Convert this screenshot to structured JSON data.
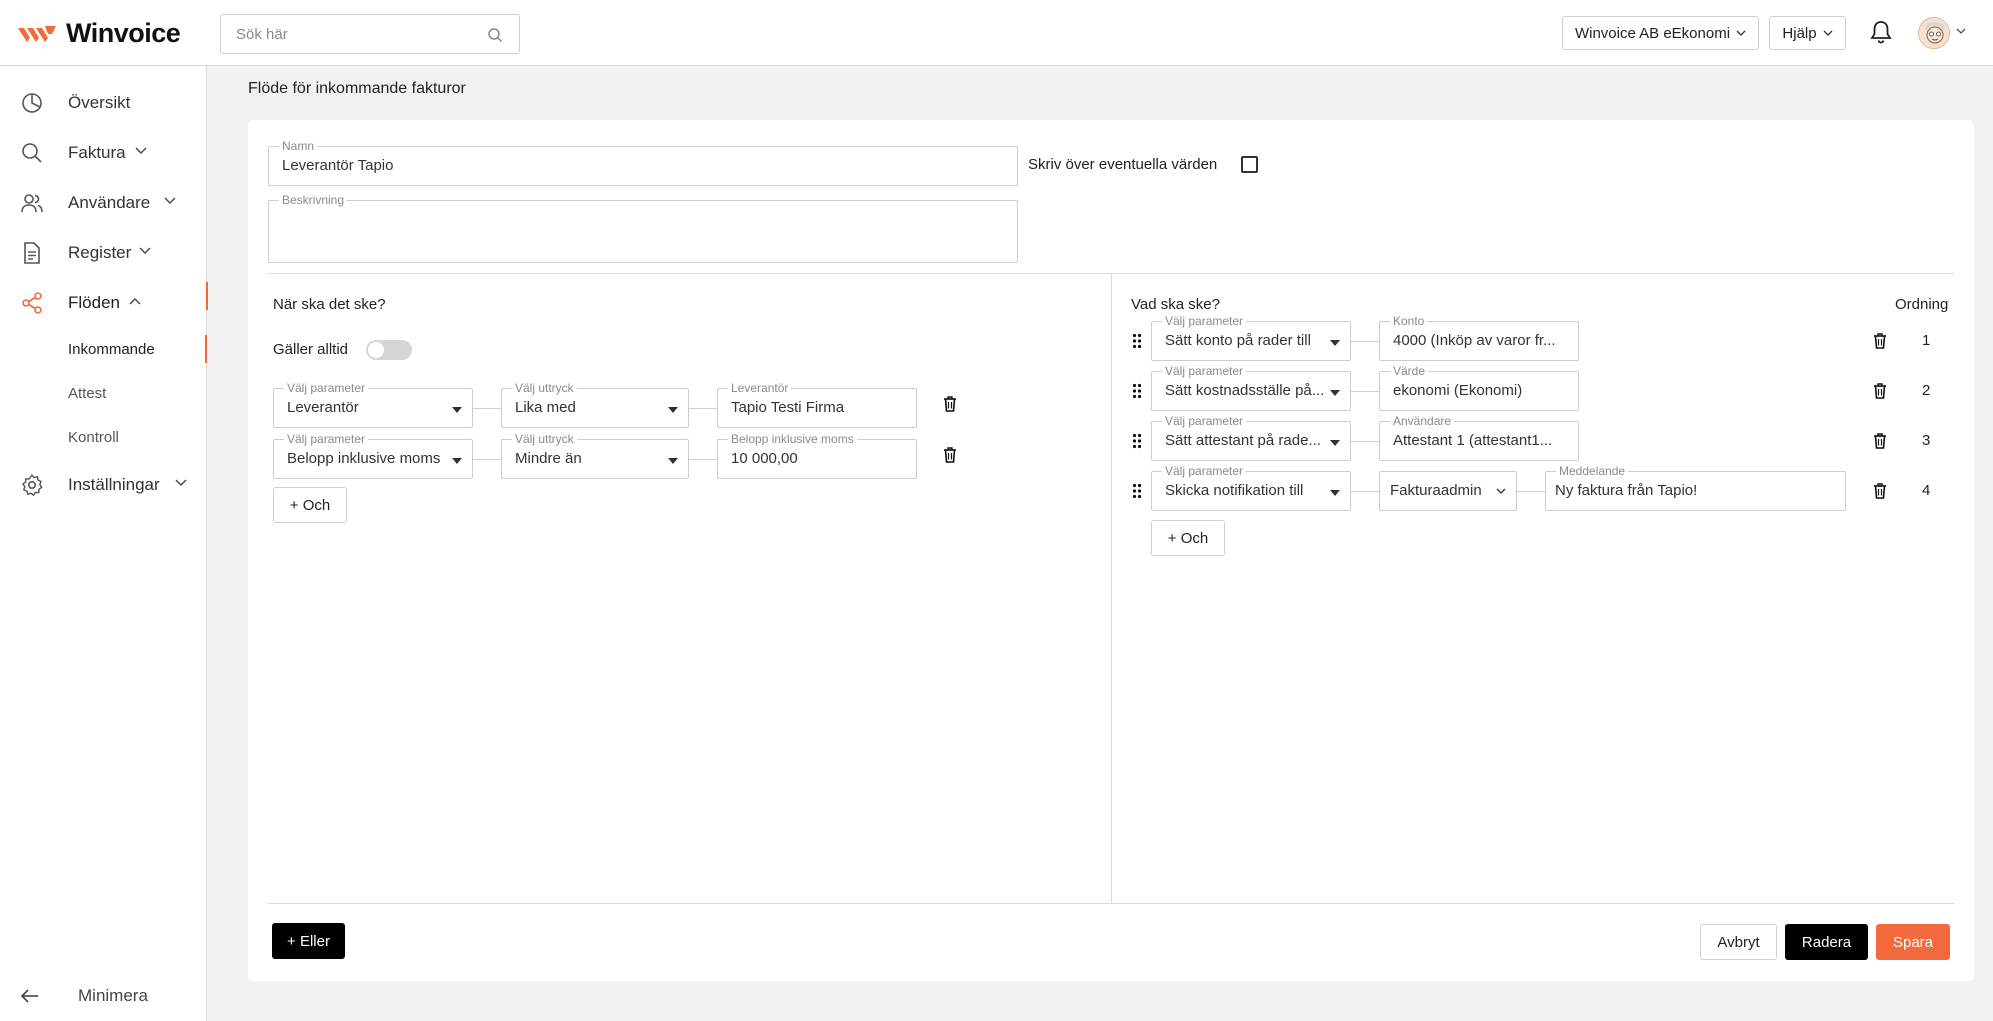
{
  "app": {
    "brand": "Winvoice",
    "search_placeholder": "Sök här",
    "company": "Winvoice AB eEkonomi",
    "help": "Hjälp",
    "brand_color": "#f26a3d"
  },
  "sidebar": {
    "items": [
      {
        "label": "Översikt",
        "icon": "pie-chart-icon"
      },
      {
        "label": "Faktura",
        "icon": "search-icon"
      },
      {
        "label": "Användare",
        "icon": "users-icon"
      },
      {
        "label": "Register",
        "icon": "document-icon"
      },
      {
        "label": "Flöden",
        "icon": "share-icon"
      },
      {
        "label": "Inställningar",
        "icon": "gear-icon"
      }
    ],
    "subitems": [
      {
        "label": "Inkommande"
      },
      {
        "label": "Attest"
      },
      {
        "label": "Kontroll"
      }
    ],
    "minimize": "Minimera"
  },
  "page": {
    "title": "Flöde för inkommande fakturor"
  },
  "form": {
    "name_label": "Namn",
    "name_value": "Leverantör Tapio",
    "description_label": "Beskrivning",
    "description_value": "",
    "overwrite_label": "Skriv över eventuella värden"
  },
  "conditions": {
    "heading": "När ska det ske?",
    "always_label": "Gäller alltid",
    "rows": [
      {
        "param_label": "Välj parameter",
        "param": "Leverantör",
        "expr_label": "Välj uttryck",
        "expr": "Lika med",
        "value_label": "Leverantör",
        "value": "Tapio Testi Firma"
      },
      {
        "param_label": "Välj parameter",
        "param": "Belopp inklusive moms",
        "expr_label": "Välj uttryck",
        "expr": "Mindre än",
        "value_label": "Belopp inklusive moms",
        "value": "10 000,00"
      }
    ],
    "and_button": "+ Och"
  },
  "actions": {
    "heading": "Vad ska ske?",
    "order_heading": "Ordning",
    "rows": [
      {
        "param_label": "Välj parameter",
        "param": "Sätt konto på rader till",
        "value_label": "Konto",
        "value": "4000 (Inköp av varor fr...",
        "order": "1"
      },
      {
        "param_label": "Välj parameter",
        "param": "Sätt kostnadsställe på...",
        "value_label": "Värde",
        "value": "ekonomi (Ekonomi)",
        "order": "2"
      },
      {
        "param_label": "Välj parameter",
        "param": "Sätt attestant på rade...",
        "value_label": "Användare",
        "value": "Attestant 1 (attestant1...",
        "order": "3"
      },
      {
        "param_label": "Välj parameter",
        "param": "Skicka notifikation till",
        "select_value": "Fakturaadmin",
        "message_label": "Meddelande",
        "message": "Ny faktura från Tapio!",
        "order": "4"
      }
    ],
    "and_button": "+ Och"
  },
  "footer": {
    "or_button": "+ Eller",
    "cancel": "Avbryt",
    "delete": "Radera",
    "save": "Spara"
  }
}
